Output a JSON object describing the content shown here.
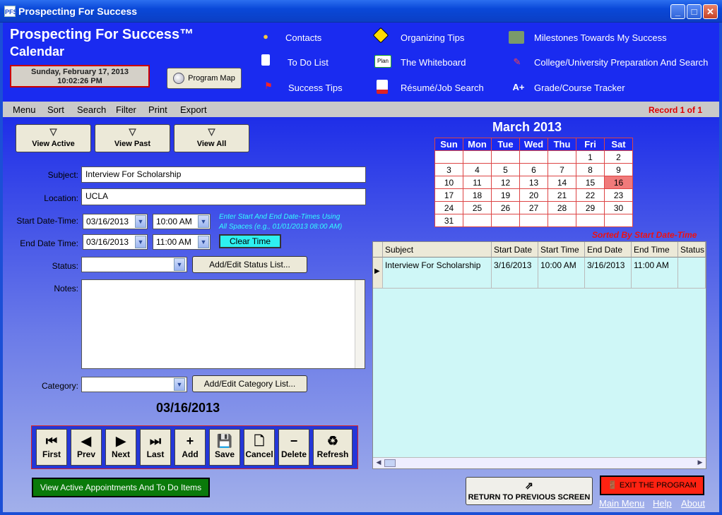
{
  "window": {
    "title": "Prospecting For Success",
    "icon_text": "PFS"
  },
  "header": {
    "title_line1": "Prospecting For Success™",
    "title_line2": "Calendar",
    "date_line1": "Sunday, February 17, 2013",
    "date_line2": "10:02:26 PM",
    "program_map_label": "Program Map",
    "links": {
      "contacts": "Contacts",
      "todo": "To Do List",
      "success_tips": "Success Tips",
      "organizing_tips": "Organizing Tips",
      "whiteboard": "The Whiteboard",
      "resume": "Résumé/Job Search",
      "milestones": "Milestones Towards My Success",
      "college": "College/University Preparation And Search",
      "grade": "Grade/Course Tracker"
    },
    "icons": {
      "whiteboard_text": "Plan",
      "grade_text": "A+"
    }
  },
  "menubar": {
    "items": [
      "Menu",
      "Sort",
      "Search",
      "Filter",
      "Print",
      "Export"
    ],
    "record_status": "Record 1 of 1"
  },
  "filters": {
    "view_active": "View Active",
    "view_past": "View Past",
    "view_all": "View All"
  },
  "form": {
    "subject_label": "Subject:",
    "subject_value": "Interview For Scholarship",
    "location_label": "Location:",
    "location_value": "UCLA",
    "start_label": "Start Date-Time:",
    "start_date": "03/16/2013",
    "start_time": "10:00 AM",
    "end_label": "End Date Time:",
    "end_date": "03/16/2013",
    "end_time": "11:00 AM",
    "hint_line1": "Enter Start And End Date-Times Using",
    "hint_line2": "All Spaces (e.g., 01/01/2013 08:00 AM)",
    "clear_time": "Clear Time",
    "status_label": "Status:",
    "status_value": "",
    "add_status": "Add/Edit Status List...",
    "notes_label": "Notes:",
    "notes_value": "",
    "category_label": "Category:",
    "category_value": "",
    "add_category": "Add/Edit Category List...",
    "current_date": "03/16/2013"
  },
  "nav_buttons": {
    "first": "First",
    "prev": "Prev",
    "next": "Next",
    "last": "Last",
    "add": "Add",
    "save": "Save",
    "cancel": "Cancel",
    "delete": "Delete",
    "refresh": "Refresh"
  },
  "view_active_appts": "View Active Appointments And To Do Items",
  "calendar": {
    "title": "March 2013",
    "days": [
      "Sun",
      "Mon",
      "Tue",
      "Wed",
      "Thu",
      "Fri",
      "Sat"
    ],
    "weeks": [
      [
        "",
        "",
        "",
        "",
        "",
        "1",
        "2"
      ],
      [
        "3",
        "4",
        "5",
        "6",
        "7",
        "8",
        "9"
      ],
      [
        "10",
        "11",
        "12",
        "13",
        "14",
        "15",
        "16"
      ],
      [
        "17",
        "18",
        "19",
        "20",
        "21",
        "22",
        "23"
      ],
      [
        "24",
        "25",
        "26",
        "27",
        "28",
        "29",
        "30"
      ],
      [
        "31",
        "",
        "",
        "",
        "",
        "",
        ""
      ]
    ],
    "selected": "16"
  },
  "sorted_label": "Sorted By Start Date-Time",
  "grid": {
    "columns": [
      "Subject",
      "Start Date",
      "Start Time",
      "End Date",
      "End Time",
      "Status"
    ],
    "rows": [
      [
        "Interview For Scholarship",
        "3/16/2013",
        "10:00 AM",
        "3/16/2013",
        "11:00 AM",
        ""
      ]
    ]
  },
  "footer": {
    "return_label": "RETURN TO PREVIOUS SCREEN",
    "exit_label": "EXIT THE PROGRAM",
    "main_menu": "Main Menu",
    "help": "Help",
    "about": "About"
  }
}
